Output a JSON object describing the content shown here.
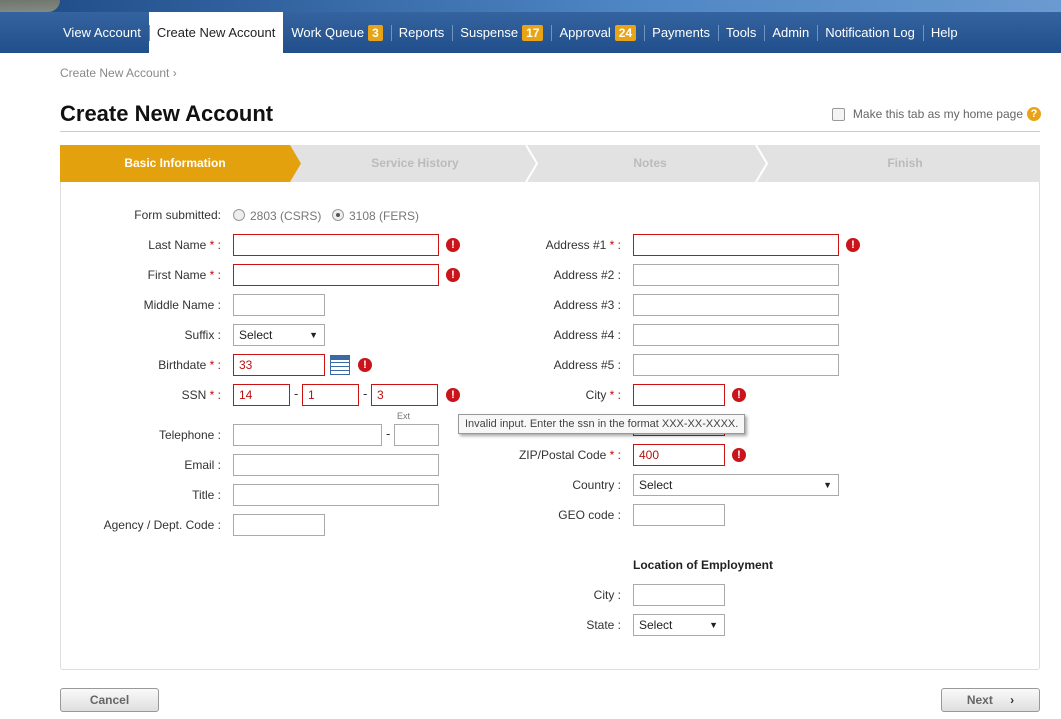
{
  "nav": {
    "items": [
      {
        "label": "View Account"
      },
      {
        "label": "Create New Account",
        "active": true
      },
      {
        "label": "Work Queue",
        "badge": "3"
      },
      {
        "label": "Reports"
      },
      {
        "label": "Suspense",
        "badge": "17"
      },
      {
        "label": "Approval",
        "badge": "24"
      },
      {
        "label": "Payments"
      },
      {
        "label": "Tools"
      },
      {
        "label": "Admin"
      },
      {
        "label": "Notification Log"
      },
      {
        "label": "Help"
      }
    ]
  },
  "breadcrumb": "Create New Account ›",
  "page_title": "Create New Account",
  "home_pref": {
    "label": "Make this tab as my home page",
    "help": "?"
  },
  "wizard": {
    "steps": [
      "Basic Information",
      "Service History",
      "Notes",
      "Finish"
    ],
    "active_step": "Basic Information"
  },
  "form": {
    "form_submitted": {
      "label": "Form submitted:",
      "options": [
        "2803 (CSRS)",
        "3108 (FERS)"
      ],
      "selected": "3108 (FERS)"
    },
    "last_name": {
      "label": "Last Name",
      "value": ""
    },
    "first_name": {
      "label": "First Name",
      "value": ""
    },
    "middle_name": {
      "label": "Middle Name :",
      "value": ""
    },
    "suffix": {
      "label": "Suffix :",
      "value": "Select"
    },
    "birthdate": {
      "label": "Birthdate",
      "value": "33"
    },
    "ssn": {
      "label": "SSN",
      "part1": "14",
      "part2": "1",
      "part3": "3"
    },
    "telephone": {
      "label": "Telephone :",
      "value": "",
      "ext_label": "Ext",
      "ext_value": ""
    },
    "email": {
      "label": "Email :",
      "value": ""
    },
    "title": {
      "label": "Title :",
      "value": ""
    },
    "agency": {
      "label": "Agency / Dept. Code :",
      "value": ""
    },
    "address1": {
      "label": "Address #1",
      "value": ""
    },
    "address2": {
      "label": "Address #2 :",
      "value": ""
    },
    "address3": {
      "label": "Address #3 :",
      "value": ""
    },
    "address4": {
      "label": "Address #4 :",
      "value": ""
    },
    "address5": {
      "label": "Address #5 :",
      "value": ""
    },
    "city": {
      "label": "City",
      "value": ""
    },
    "zip": {
      "label": "ZIP/Postal Code",
      "value": "400"
    },
    "country": {
      "label": "Country :",
      "value": "Select"
    },
    "geo_code": {
      "label": "GEO code :",
      "value": ""
    },
    "employment": {
      "title": "Location of Employment",
      "city": {
        "label": "City :",
        "value": ""
      },
      "state": {
        "label": "State :",
        "value": "Select"
      }
    },
    "required_suffix": " * :",
    "ssn_tooltip": "Invalid input. Enter the ssn in the format XXX-XX-XXXX.",
    "error_glyph": "!"
  },
  "buttons": {
    "cancel": "Cancel",
    "next": "Next"
  }
}
